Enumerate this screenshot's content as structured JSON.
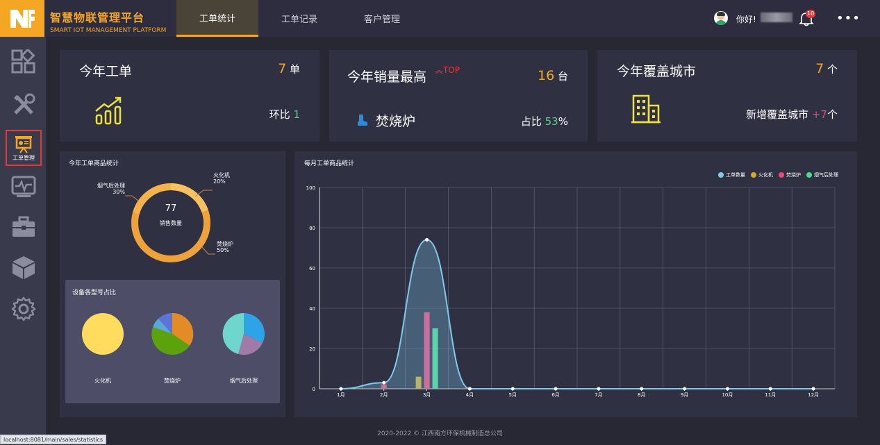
{
  "brand": {
    "name_cn": "智慧物联管理平台",
    "name_en": "SMART IOT MANAGEMENT PLATFORM",
    "logo_icon": "nf-logo"
  },
  "nav": {
    "tabs": [
      {
        "label": "工单统计",
        "active": true
      },
      {
        "label": "工单记录",
        "active": false
      },
      {
        "label": "客户管理",
        "active": false
      }
    ]
  },
  "user": {
    "greeting": "你好!",
    "notification_count": "10"
  },
  "sidebar": {
    "active_label": "工单管理"
  },
  "stats": {
    "card1": {
      "title": "今年工单",
      "value": "7",
      "unit": "单",
      "sub_label": "环比",
      "sub_value": "1"
    },
    "card2": {
      "title": "今年销量最高",
      "badge": "TOP",
      "value": "16",
      "unit": "台",
      "product": "焚烧炉",
      "sub_label": "占比",
      "sub_value": "53",
      "sub_unit": "%"
    },
    "card3": {
      "title": "今年覆盖城市",
      "value": "7",
      "unit": "个",
      "sub_label": "新增覆盖城市",
      "sub_value": "+7",
      "sub_unit": "个"
    }
  },
  "donut": {
    "title": "今年工单商品统计",
    "center_value": "77",
    "center_label": "销售数量",
    "labels": [
      {
        "name": "火化机",
        "pct": "20%"
      },
      {
        "name": "烟气后处理",
        "pct": "30%"
      },
      {
        "name": "焚烧炉",
        "pct": "50%"
      }
    ]
  },
  "models": {
    "title": "设备各型号占比",
    "pies": [
      {
        "label": "火化机"
      },
      {
        "label": "焚烧炉"
      },
      {
        "label": "烟气后处理"
      }
    ]
  },
  "chart_data": {
    "type": "line",
    "title": "每月工单商品统计",
    "categories": [
      "1月",
      "2月",
      "3月",
      "4月",
      "5月",
      "6月",
      "7月",
      "8月",
      "9月",
      "10月",
      "11月",
      "12月"
    ],
    "ylim": [
      0,
      100
    ],
    "yticks": [
      "0",
      "20",
      "40",
      "60",
      "80",
      "100"
    ],
    "legend": [
      "工单数量",
      "火化机",
      "焚烧炉",
      "烟气后处理"
    ],
    "legend_position": "top-right",
    "colors": {
      "工单数量": "#7ecbee",
      "火化机": "#d4a82a",
      "焚烧炉": "#f0477b",
      "烟气后处理": "#4cd98a"
    },
    "series": [
      {
        "name": "工单数量",
        "type": "line",
        "values": [
          0,
          3,
          74,
          0,
          0,
          0,
          0,
          0,
          0,
          0,
          0,
          0
        ]
      },
      {
        "name": "火化机",
        "type": "bar",
        "values": [
          0,
          0,
          6,
          0,
          0,
          0,
          0,
          0,
          0,
          0,
          0,
          0
        ]
      },
      {
        "name": "焚烧炉",
        "type": "bar",
        "values": [
          0,
          2,
          38,
          0,
          0,
          0,
          0,
          0,
          0,
          0,
          0,
          0
        ]
      },
      {
        "name": "烟气后处理",
        "type": "bar",
        "values": [
          0,
          0,
          30,
          0,
          0,
          0,
          0,
          0,
          0,
          0,
          0,
          0
        ]
      }
    ]
  },
  "footer": {
    "text": "2020-2022 © 江西南方环保机械制造总公司"
  },
  "status_url": "localhost:8081/main/sales/statistics"
}
